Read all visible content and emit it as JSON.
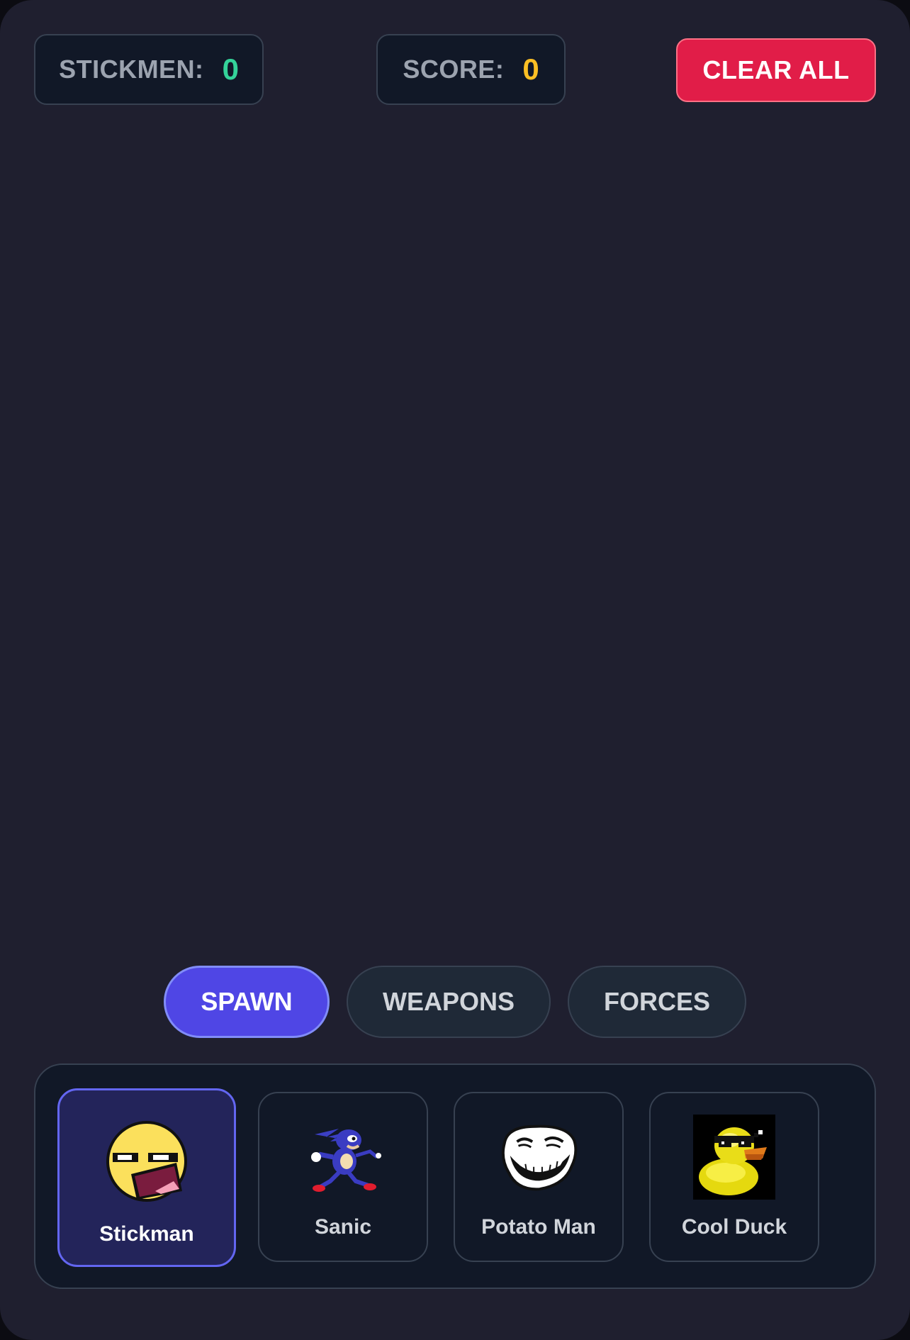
{
  "stats": {
    "stickmen_label": "STICKMEN:",
    "stickmen_value": "0",
    "score_label": "SCORE:",
    "score_value": "0"
  },
  "actions": {
    "clear_all_label": "CLEAR ALL"
  },
  "tabs": [
    {
      "label": "SPAWN",
      "active": true
    },
    {
      "label": "WEAPONS",
      "active": false
    },
    {
      "label": "FORCES",
      "active": false
    }
  ],
  "spawn_items": [
    {
      "label": "Stickman",
      "icon": "awesome-face-icon",
      "selected": true
    },
    {
      "label": "Sanic",
      "icon": "sanic-icon",
      "selected": false
    },
    {
      "label": "Potato Man",
      "icon": "trollface-icon",
      "selected": false
    },
    {
      "label": "Cool Duck",
      "icon": "cool-duck-icon",
      "selected": false
    }
  ],
  "colors": {
    "background": "#1f1f2f",
    "stickmen_value": "#34d399",
    "score_value": "#fbbf24",
    "clear_button": "#e11d48",
    "active_tab": "#4f46e5",
    "selected_item": "#23245a"
  }
}
